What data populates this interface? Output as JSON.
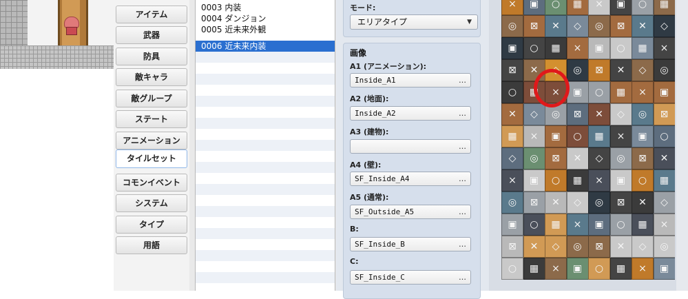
{
  "categories": [
    {
      "label": "アイテム"
    },
    {
      "label": "武器"
    },
    {
      "label": "防具"
    },
    {
      "label": "敵キャラ"
    },
    {
      "label": "敵グループ"
    },
    {
      "label": "ステート"
    },
    {
      "label": "アニメーション"
    },
    {
      "label": "タイルセット",
      "active": true
    },
    {
      "label": "コモンイベント"
    },
    {
      "label": "システム"
    },
    {
      "label": "タイプ"
    },
    {
      "label": "用語"
    }
  ],
  "tileset_list": {
    "items": [
      {
        "label": "0003 内装"
      },
      {
        "label": "0004 ダンジョン"
      },
      {
        "label": "0005 近未来外観"
      },
      {
        "label": "0006 近未来内装",
        "selected": true
      }
    ]
  },
  "properties": {
    "mode_label": "モード:",
    "mode_value": "エリアタイプ",
    "image_section": "画像",
    "fields": [
      {
        "label": "A1 (アニメーション):",
        "value": "Inside_A1",
        "button": "…"
      },
      {
        "label": "A2 (地面):",
        "value": "Inside_A2",
        "button": "…"
      },
      {
        "label": "A3 (建物):",
        "value": "",
        "button": "…"
      },
      {
        "label": "A4 (壁):",
        "value": "SF_Inside_A4",
        "button": "…"
      },
      {
        "label": "A5 (通常):",
        "value": "SF_Outside_A5",
        "button": "…"
      },
      {
        "label": "B:",
        "value": "SF_Inside_B",
        "button": "…"
      },
      {
        "label": "C:",
        "value": "SF_Inside_C",
        "button": "…"
      }
    ]
  },
  "tile_palette": {
    "highlight_color": "#e0191b",
    "selected_tile": "orange-x-tile"
  }
}
